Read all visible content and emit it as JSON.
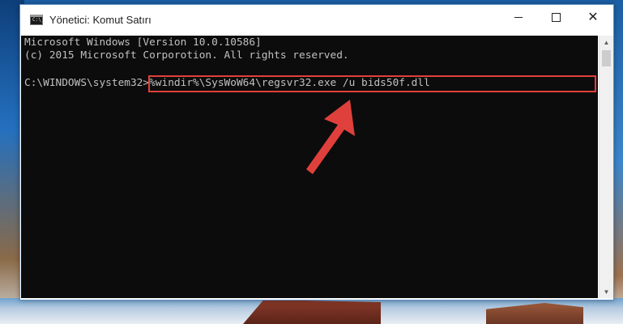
{
  "window": {
    "title": "Yönetici: Komut Satırı",
    "icon_label": "C:\\_",
    "controls": {
      "minimize": "minimize-icon",
      "maximize": "maximize-icon",
      "close": "close-icon"
    }
  },
  "console": {
    "line1": "Microsoft Windows [Version 10.0.10586]",
    "line2": "(c) 2015 Microsoft Corporotion. All rights reserved.",
    "prompt": "C:\\WINDOWS\\system32>",
    "command": "%windir%\\SysWoW64\\regsvr32.exe /u bids50f.dll"
  },
  "colors": {
    "console_bg": "#0c0c0c",
    "console_text": "#c0c0c0",
    "annotation": "#e0403c"
  },
  "icons": {
    "app": "cmd-icon",
    "arrow": "red-arrow-annotation",
    "scroll_up": "scroll-up-icon",
    "scroll_down": "scroll-down-icon"
  }
}
